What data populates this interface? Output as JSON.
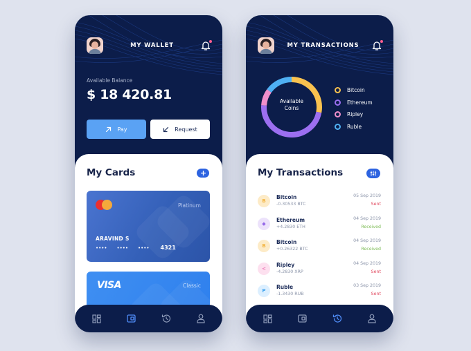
{
  "colors": {
    "background": "#dfe3ee",
    "phone_dark": "#0c1d4a",
    "accent_blue": "#2d63e0",
    "pay_button": "#5aa2f4",
    "sent": "#e0465c",
    "received": "#7cbb54",
    "nav_icon": "#8d9ab8",
    "nav_active": "#4f8cf7"
  },
  "wallet": {
    "header": {
      "title": "MY WALLET",
      "avatar": "user-avatar",
      "notification_icon": "bell-icon",
      "has_notification": true
    },
    "balance": {
      "label": "Available Balance",
      "value": "$ 18 420.81"
    },
    "actions": [
      {
        "label": "Pay",
        "icon": "arrow-up-right-icon"
      },
      {
        "label": "Request",
        "icon": "arrow-down-left-icon"
      }
    ],
    "cards_section": {
      "title": "My Cards",
      "add_icon": "plus-icon",
      "cards": [
        {
          "brand": "Mastercard",
          "tier": "Platinum",
          "holder": "ARAVIND S",
          "masked_groups": [
            "••••",
            "••••",
            "••••"
          ],
          "last4": "4321"
        },
        {
          "brand": "VISA",
          "tier": "Classic"
        }
      ]
    },
    "nav": {
      "items": [
        {
          "name": "dashboard",
          "icon": "grid-icon",
          "active": false
        },
        {
          "name": "wallet",
          "icon": "wallet-icon",
          "active": true
        },
        {
          "name": "history",
          "icon": "history-icon",
          "active": false
        },
        {
          "name": "profile",
          "icon": "user-icon",
          "active": false
        }
      ]
    }
  },
  "transactions": {
    "header": {
      "title": "MY TRANSACTIONS",
      "avatar": "user-avatar",
      "notification_icon": "bell-icon",
      "has_notification": true
    },
    "donut_center": {
      "line1": "Available",
      "line2": "Coins"
    },
    "section_title": "My Transactions",
    "filter_icon": "sliders-icon",
    "list": [
      {
        "coin": "Bitcoin",
        "symbol": "B",
        "amount": "-0.30533 BTC",
        "date": "05 Sep 2019",
        "status": "Sent",
        "icon_bg": "#fdebc7",
        "icon_color": "#f2b440"
      },
      {
        "coin": "Ethereum",
        "symbol": "◆",
        "amount": "+4.2830 ETH",
        "date": "04 Sep 2019",
        "status": "Received",
        "icon_bg": "#ece2fb",
        "icon_color": "#9468e8"
      },
      {
        "coin": "Bitcoin",
        "symbol": "B",
        "amount": "+0.26322 BTC",
        "date": "04 Sep 2019",
        "status": "Received",
        "icon_bg": "#fdebc7",
        "icon_color": "#f2b440"
      },
      {
        "coin": "Ripley",
        "symbol": "<",
        "amount": "-4.2830 XRP",
        "date": "04 Sep 2019",
        "status": "Sent",
        "icon_bg": "#fde0ef",
        "icon_color": "#ec72b3"
      },
      {
        "coin": "Ruble",
        "symbol": "P",
        "amount": "-1.3430 RUB",
        "date": "03 Sep 2019",
        "status": "Sent",
        "icon_bg": "#dcefff",
        "icon_color": "#48a7f0"
      }
    ],
    "nav": {
      "items": [
        {
          "name": "dashboard",
          "icon": "grid-icon",
          "active": false
        },
        {
          "name": "wallet",
          "icon": "wallet-icon",
          "active": false
        },
        {
          "name": "history",
          "icon": "history-icon",
          "active": true
        },
        {
          "name": "profile",
          "icon": "user-icon",
          "active": false
        }
      ]
    }
  },
  "chart_data": {
    "type": "pie",
    "variant": "donut",
    "title": "Available Coins",
    "categories": [
      "Bitcoin",
      "Ethereum",
      "Ripley",
      "Ruble"
    ],
    "values": [
      28,
      48,
      9,
      15
    ],
    "unit": "percent (estimated from arc lengths)",
    "colors": [
      "#f9c24f",
      "#9c6ff0",
      "#f08fcb",
      "#4fb0f3"
    ],
    "start_angle": "top, clockwise",
    "legend": "right"
  }
}
